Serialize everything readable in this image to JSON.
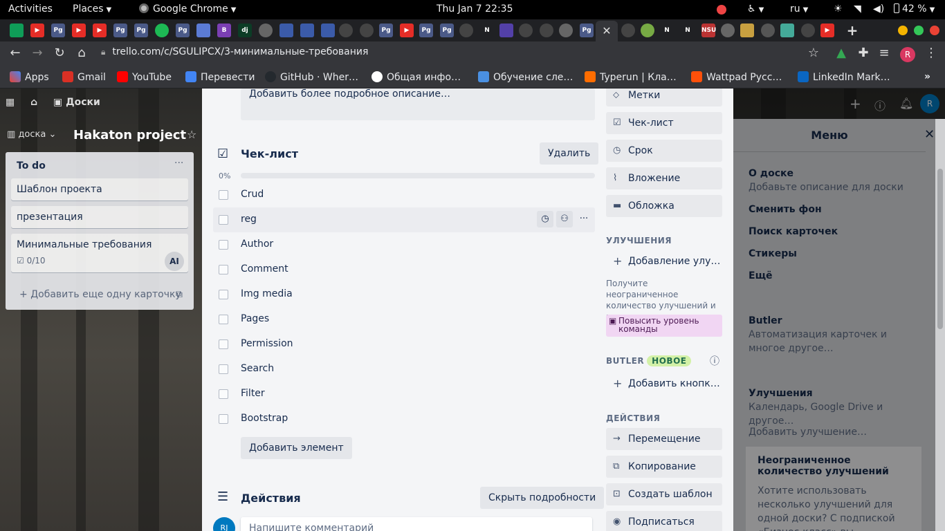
{
  "system_bar": {
    "activities": "Activities",
    "places": "Places",
    "app": "Google Chrome",
    "clock": "Thu Jan 7  22:35",
    "language": "ru",
    "battery": "42 %"
  },
  "browser": {
    "url": "trello.com/c/SGULIPCX/3-минимальные-требования",
    "profile_initial": "R",
    "bookmarks": [
      {
        "label": "Apps",
        "color": "#ea4335"
      },
      {
        "label": "Gmail",
        "color": "#d93025"
      },
      {
        "label": "YouTube",
        "color": "#ff0000"
      },
      {
        "label": "Перевести",
        "color": "#4285f4"
      },
      {
        "label": "GitHub · Wher…",
        "color": "#24292e"
      },
      {
        "label": "Общая инфо…",
        "color": "#ffffff"
      },
      {
        "label": "Обучение сле…",
        "color": "#4a90e2"
      },
      {
        "label": "Typerun | Кла…",
        "color": "#ff6d00"
      },
      {
        "label": "Wattpad Русс…",
        "color": "#ff500a"
      },
      {
        "label": "LinkedIn Mark…",
        "color": "#0a66c2"
      }
    ]
  },
  "board": {
    "nav_label": "Доски",
    "view_label": "доска",
    "title": "Hakaton project",
    "list": {
      "title": "To do",
      "cards": [
        {
          "title": "Шаблон проекта"
        },
        {
          "title": "презентация"
        },
        {
          "title": "Минимальные требования",
          "badge": "0/10",
          "member": "AI"
        }
      ],
      "add_card": "Добавить еще одну карточку"
    }
  },
  "card_modal": {
    "description_placeholder": "Добавить более подробное описание…",
    "checklist": {
      "title": "Чек-лист",
      "delete_button": "Удалить",
      "progress_label": "0%",
      "progress_value": 0,
      "items": [
        "Crud",
        "reg",
        "Author",
        "Comment",
        "Img media",
        "Pages",
        "Permission",
        "Search",
        "Filter",
        "Bootstrap"
      ],
      "add_item_button": "Добавить элемент"
    },
    "activity": {
      "title": "Действия",
      "toggle_button": "Скрыть подробности",
      "comment_placeholder": "Напишите комментарий",
      "avatar": "RJ"
    },
    "sidebar": {
      "top_buttons": [
        "Метки",
        "Чек-лист",
        "Срок",
        "Вложение",
        "Обложка"
      ],
      "powerups_heading": "УЛУЧШЕНИЯ",
      "add_powerup": "Добавление улу…",
      "powerups_note": "Получите неограниченное количество улучшений и многое другое.",
      "upgrade_button": "Повысить уровень команды",
      "butler_heading": "BUTLER",
      "butler_badge": "НОВОЕ",
      "add_button": "Добавить кнопк…",
      "actions_heading": "ДЕЙСТВИЯ",
      "action_buttons": [
        "Перемещение",
        "Копирование",
        "Создать шаблон",
        "Подписаться"
      ]
    }
  },
  "menu": {
    "title": "Меню",
    "items": [
      {
        "title": "О доске",
        "sub": "Добавьте описание для доски"
      },
      {
        "title": "Сменить фон"
      },
      {
        "title": "Поиск карточек"
      },
      {
        "title": "Стикеры"
      },
      {
        "title": "Ещё"
      },
      {
        "title": "Butler",
        "sub": "Автоматизация карточек и многое другое…"
      },
      {
        "title": "Улучшения",
        "sub": "Календарь, Google Drive и другое…"
      }
    ],
    "add_powerup": "Добавить улучшение…",
    "promo_title": "Неограниченное количество улучшений",
    "promo_text": "Хотите использовать несколько улучшений для одной доски? С подпиской «Бизнес-класс» вы"
  }
}
